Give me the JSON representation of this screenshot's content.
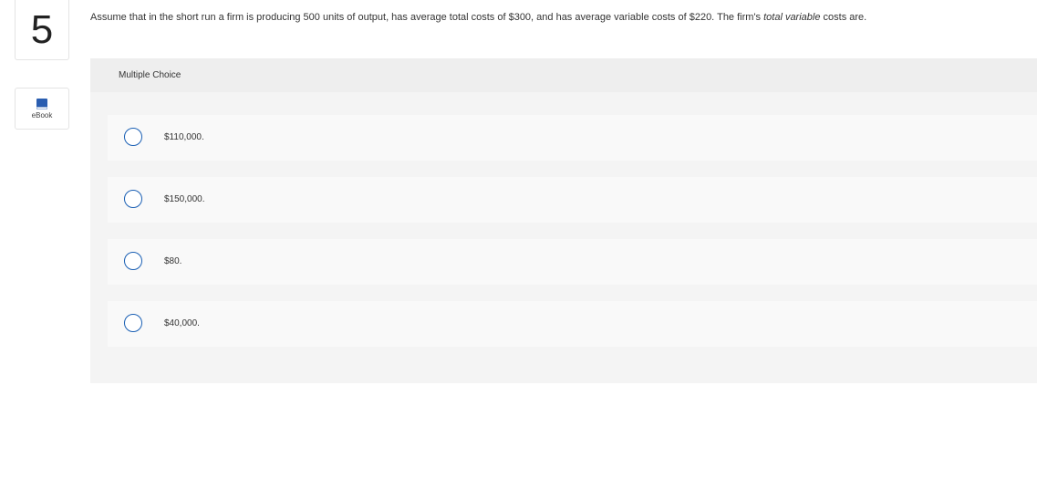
{
  "question": {
    "number": "5",
    "text_before": "Assume that in the short run a firm is producing 500 units of output, has average total costs of $300, and has average variable costs of $220. The firm's ",
    "text_emphasis": "total variable",
    "text_after": " costs are."
  },
  "ebook": {
    "label": "eBook",
    "icon": "book-icon"
  },
  "multiple_choice": {
    "title": "Multiple Choice",
    "options": [
      {
        "label": "$110,000."
      },
      {
        "label": "$150,000."
      },
      {
        "label": "$80."
      },
      {
        "label": "$40,000."
      }
    ]
  },
  "colors": {
    "radio_border": "#1a5fb4",
    "panel_bg": "#f4f4f4",
    "option_bg": "#f9f9f9",
    "ebook_icon": "#2a5db0"
  }
}
